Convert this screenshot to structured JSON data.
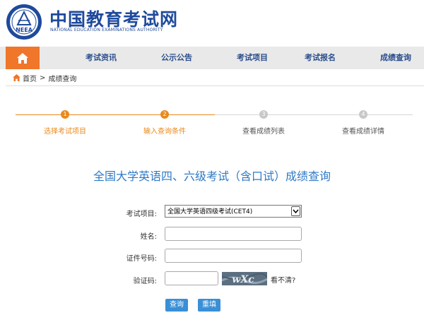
{
  "brand": {
    "title_cn": "中国教育考试网",
    "title_en": "NATIONAL EDUCATION EXAMINATIONS AUTHORITY",
    "seal_text": "NEEA"
  },
  "nav": {
    "home_icon": "home-icon",
    "items": [
      "考试资讯",
      "公示公告",
      "考试项目",
      "考试报名",
      "成绩查询"
    ]
  },
  "breadcrumb": {
    "home": "首页",
    "separator": ">",
    "current": "成绩查询"
  },
  "steps": [
    {
      "num": "1",
      "label": "选择考试项目",
      "state": "done"
    },
    {
      "num": "2",
      "label": "输入查询条件",
      "state": "current"
    },
    {
      "num": "3",
      "label": "查看成绩列表",
      "state": "todo"
    },
    {
      "num": "4",
      "label": "查看成绩详情",
      "state": "todo"
    }
  ],
  "title": "全国大学英语四、六级考试（含口试）成绩查询",
  "form": {
    "exam_label": "考试项目:",
    "exam_value": "全国大学英语四级考试(CET4)",
    "name_label": "姓名:",
    "name_value": "",
    "id_label": "证件号码:",
    "id_value": "",
    "captcha_label": "验证码:",
    "captcha_value": "",
    "captcha_text": "wXc",
    "refresh_text": "看不清?"
  },
  "buttons": {
    "query": "查询",
    "reset": "重填"
  },
  "colors": {
    "accent": "#f0762a",
    "step_active": "#e98a1c",
    "step_inactive": "#c8c8c8",
    "title": "#2e79c6",
    "button": "#3a8fd6",
    "brand": "#1f4a9c"
  }
}
